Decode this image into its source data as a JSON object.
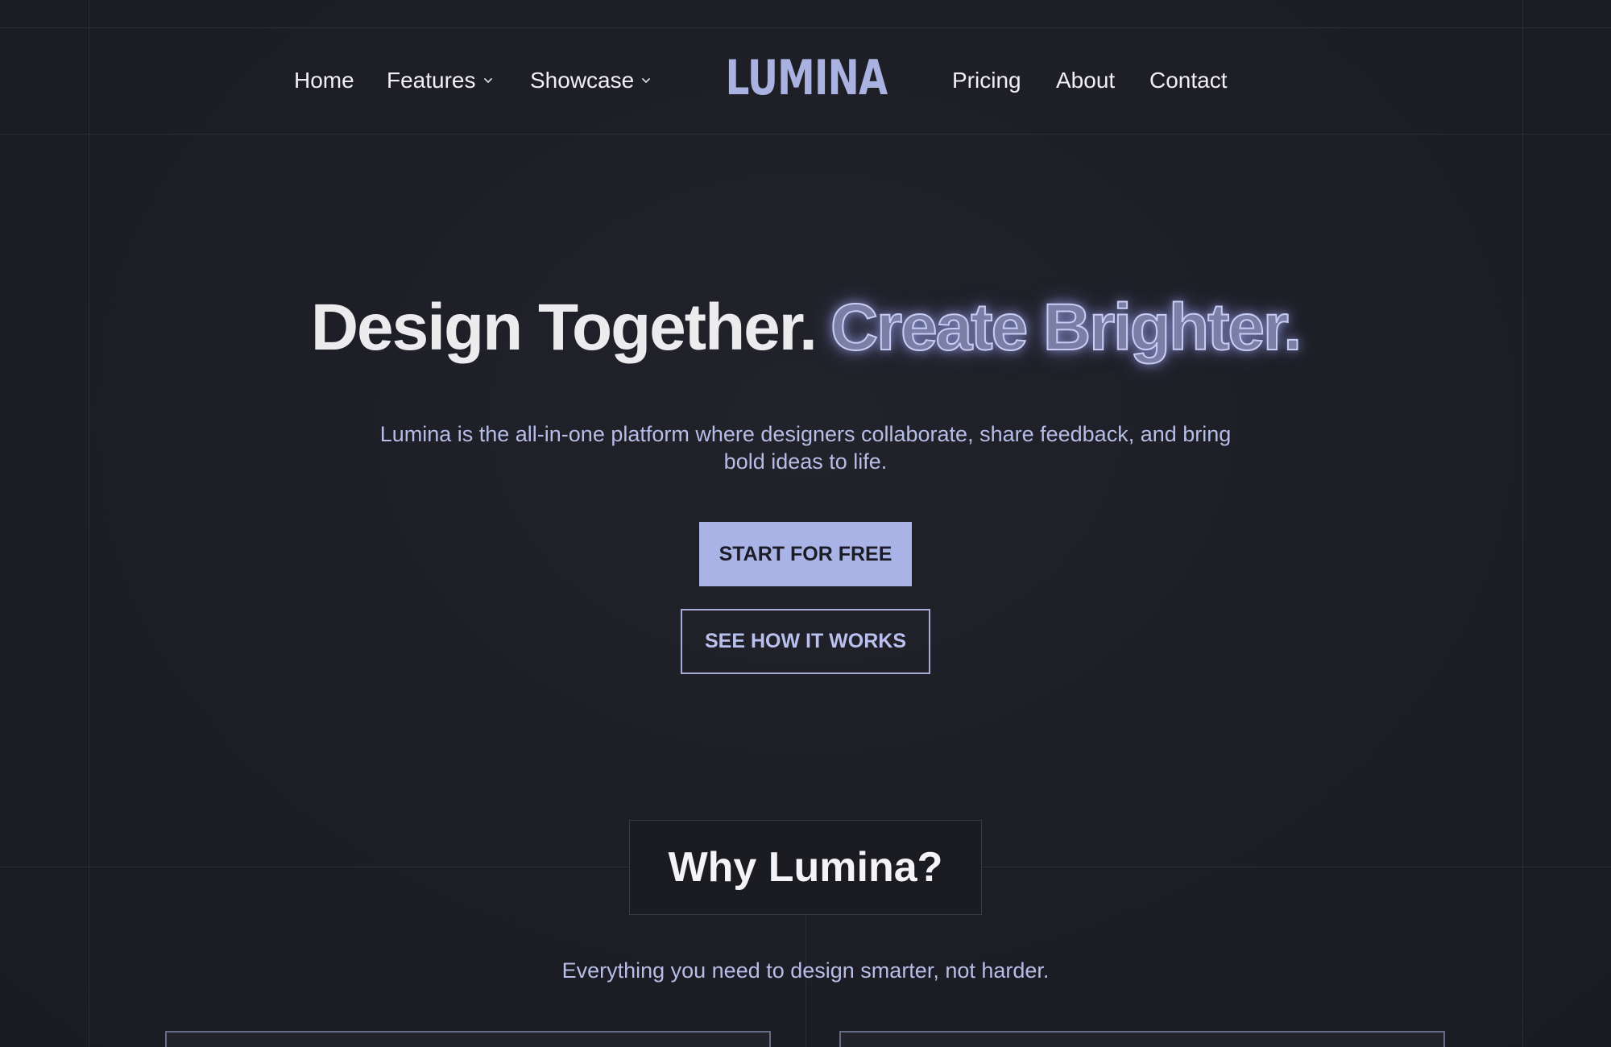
{
  "nav": {
    "left_items": [
      {
        "label": "Home",
        "has_dropdown": false
      },
      {
        "label": "Features",
        "has_dropdown": true
      },
      {
        "label": "Showcase",
        "has_dropdown": true
      }
    ],
    "logo": "LUMINA",
    "right_items": [
      {
        "label": "Pricing"
      },
      {
        "label": "About"
      },
      {
        "label": "Contact"
      }
    ]
  },
  "hero": {
    "title_solid": "Design Together.",
    "title_outline": "Create Brighter.",
    "subtitle": "Lumina is the all-in-one platform where designers collaborate, share feedback, and bring bold ideas to life.",
    "primary_cta": "START FOR FREE",
    "secondary_cta": "SEE HOW IT WORKS"
  },
  "why": {
    "title": "Why Lumina?",
    "subtitle": "Everything you need to design smarter, not harder."
  },
  "colors": {
    "background": "#1d1d25",
    "accent": "#a9b3e6",
    "text_muted": "#b6bde6"
  }
}
